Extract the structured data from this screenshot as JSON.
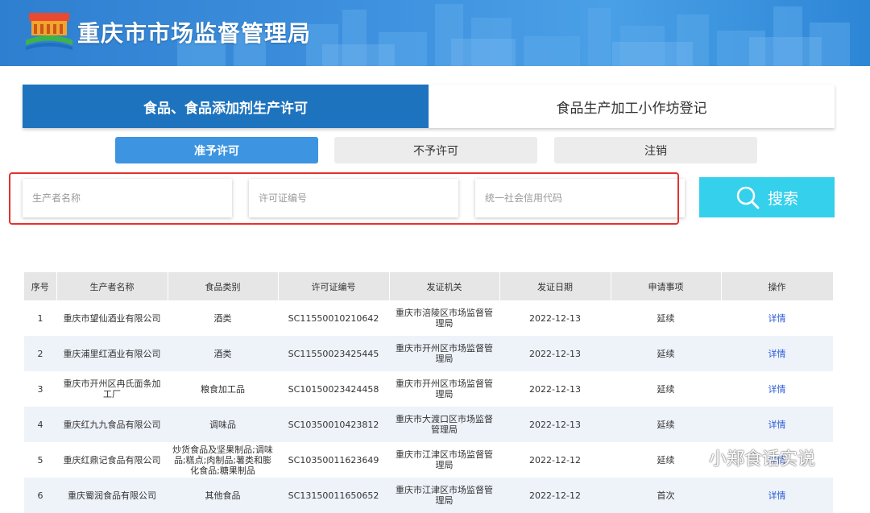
{
  "header": {
    "title": "重庆市市场监督管理局",
    "bg_color": "#2f7fd0"
  },
  "main_tabs": [
    {
      "label": "食品、食品添加剂生产许可",
      "active": true
    },
    {
      "label": "食品生产加工小作坊登记",
      "active": false
    }
  ],
  "sub_tabs": [
    {
      "label": "准予许可",
      "active": true
    },
    {
      "label": "不予许可",
      "active": false
    },
    {
      "label": "注销",
      "active": false
    }
  ],
  "search": {
    "producer_placeholder": "生产者名称",
    "license_placeholder": "许可证编号",
    "credit_code_placeholder": "统一社会信用代码",
    "button_label": "搜索",
    "icon": "search-icon",
    "button_color": "#35d0ec",
    "highlight_color": "#e5312b"
  },
  "table": {
    "headers": [
      "序号",
      "生产者名称",
      "食品类别",
      "许可证编号",
      "发证机关",
      "发证日期",
      "申请事项",
      "操作"
    ],
    "rows": [
      [
        "1",
        "重庆市望仙酒业有限公司",
        "酒类",
        "SC11550010210642",
        "重庆市涪陵区市场监督管理局",
        "2022-12-13",
        "延续",
        "详情"
      ],
      [
        "2",
        "重庆浦里红酒业有限公司",
        "酒类",
        "SC11550023425445",
        "重庆市开州区市场监督管理局",
        "2022-12-13",
        "延续",
        "详情"
      ],
      [
        "3",
        "重庆市开州区冉氏面条加工厂",
        "粮食加工品",
        "SC10150023424458",
        "重庆市开州区市场监督管理局",
        "2022-12-13",
        "延续",
        "详情"
      ],
      [
        "4",
        "重庆红九九食品有限公司",
        "调味品",
        "SC10350010423812",
        "重庆市大渡口区市场监督管理局",
        "2022-12-13",
        "延续",
        "详情"
      ],
      [
        "5",
        "重庆红鼎记食品有限公司",
        "炒货食品及坚果制品;调味品;糕点;肉制品;薯类和膨化食品;糖果制品",
        "SC10350011623649",
        "重庆市江津区市场监督管理局",
        "2022-12-12",
        "延续",
        "详情"
      ],
      [
        "6",
        "重庆蜀润食品有限公司",
        "其他食品",
        "SC13150011650652",
        "重庆市江津区市场监督管理局",
        "2022-12-12",
        "首次",
        "详情"
      ]
    ]
  },
  "watermark": {
    "text": "小郑食话实说",
    "icon": "wechat-icon"
  }
}
